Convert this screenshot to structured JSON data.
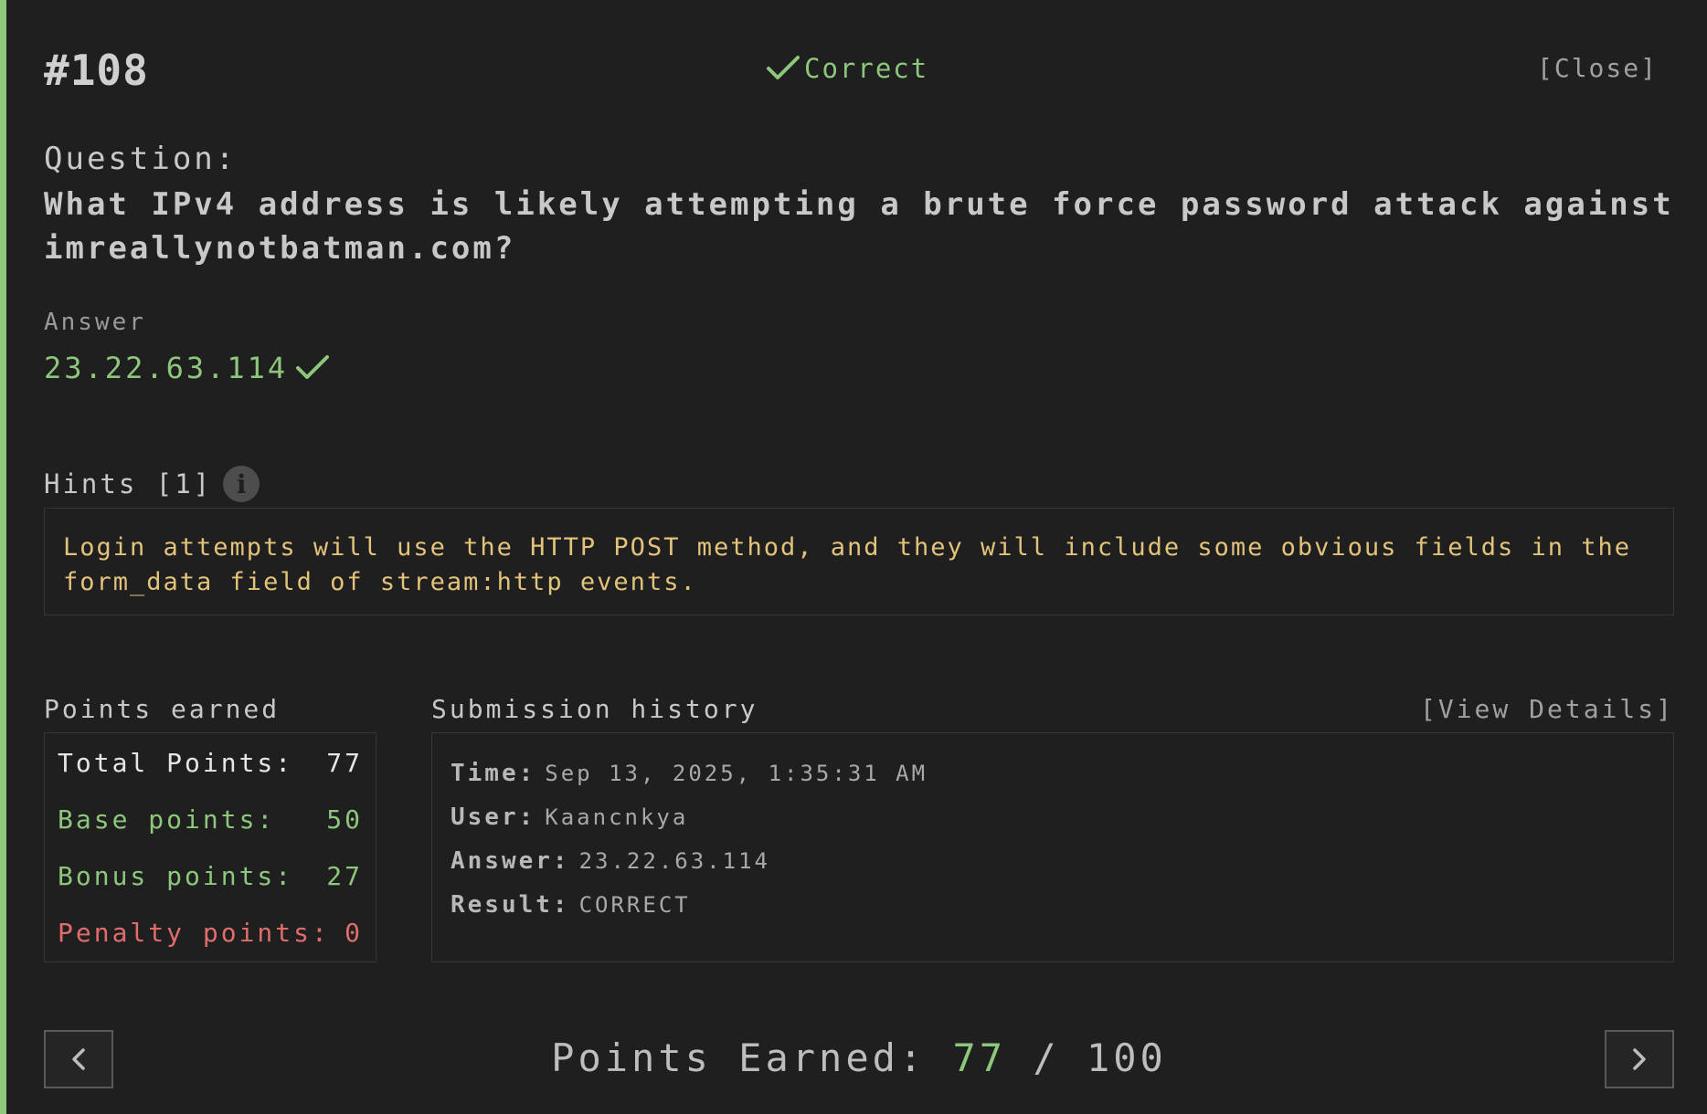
{
  "header": {
    "number": "#108",
    "status": "Correct",
    "close_label": "[Close]"
  },
  "question": {
    "label": "Question:",
    "text": "What IPv4 address is likely attempting a brute force password attack against imreallynotbatman.com?"
  },
  "answer": {
    "label": "Answer",
    "value": "23.22.63.114"
  },
  "hints": {
    "title": "Hints [1]",
    "text": "Login attempts will use the HTTP POST method, and they will include some obvious fields in the form_data field of stream:http events."
  },
  "points": {
    "title": "Points earned",
    "rows": [
      {
        "label": "Total Points:",
        "value": "77"
      },
      {
        "label": "Base points:",
        "value": "50"
      },
      {
        "label": "Bonus points:",
        "value": "27"
      },
      {
        "label": "Penalty points:",
        "value": "0"
      }
    ]
  },
  "history": {
    "title": "Submission history",
    "view_details_label": "[View Details]",
    "rows": [
      {
        "key": "Time:",
        "value": "Sep 13, 2025, 1:35:31 AM"
      },
      {
        "key": "User:",
        "value": "Kaancnkya"
      },
      {
        "key": "Answer:",
        "value": "23.22.63.114"
      },
      {
        "key": "Result:",
        "value": "CORRECT"
      }
    ]
  },
  "footer": {
    "label": "Points Earned:",
    "earned": "77",
    "separator": "/",
    "total": "100"
  },
  "icons": {
    "status": "checkmark-icon",
    "answer": "checkmark-icon",
    "hint_info": "info-icon",
    "prev": "chevron-left-icon",
    "next": "chevron-right-icon"
  },
  "colors": {
    "accent": "#8cc77b",
    "hint": "#e3c27a",
    "penalty": "#e06c6c",
    "background": "#1f1f1f"
  }
}
